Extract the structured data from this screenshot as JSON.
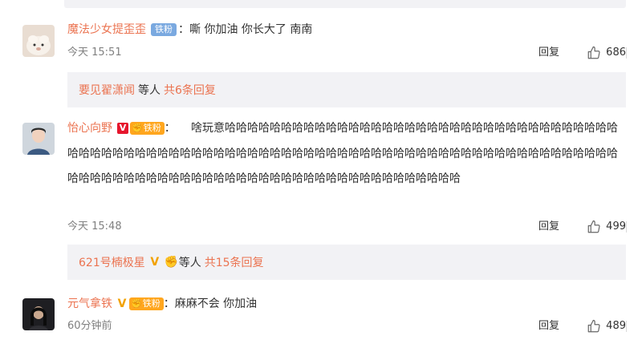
{
  "comments": [
    {
      "user": "魔法少女提歪歪",
      "fan_badge": "铁粉",
      "text": "嘶 你加油 你长大了 南南",
      "time": "今天 15:51",
      "reply_label": "回复",
      "likes": "686",
      "reply_preview": {
        "who": "要见翟潇闻",
        "etc": "等人",
        "count": "共6条回复"
      }
    },
    {
      "user": "怡心向野",
      "fan_badge": "铁粉",
      "text": "啥玩意哈哈哈哈哈哈哈哈哈哈哈哈哈哈哈哈哈哈哈哈哈哈哈哈哈哈哈哈哈哈哈哈哈哈哈哈哈哈哈哈哈哈哈哈哈哈哈哈哈哈哈哈哈哈哈哈哈哈哈哈哈哈哈哈哈哈哈哈哈哈哈哈哈哈哈哈哈哈哈哈哈哈哈哈哈哈哈哈哈哈哈哈哈哈哈哈哈哈哈哈哈哈哈哈哈哈哈哈哈哈哈哈哈哈哈哈哈哈哈",
      "time": "今天 15:48",
      "reply_label": "回复",
      "likes": "499",
      "reply_preview": {
        "who": "621号楠极星",
        "etc": "等人",
        "count": "共15条回复"
      }
    },
    {
      "user": "元气拿铁",
      "fan_badge": "铁粉",
      "text": "麻麻不会 你加油",
      "time": "60分钟前",
      "reply_label": "回复",
      "likes": "489"
    }
  ],
  "icons": {
    "like": "thumbs-up-icon",
    "vip": "v-badge-icon",
    "fan": "fist-badge-icon"
  },
  "colors": {
    "username": "#eb7350",
    "fan_badge": "#7aa9e0",
    "gold_badge": "#ffa61e",
    "reply_bg": "#f2f2f5"
  }
}
